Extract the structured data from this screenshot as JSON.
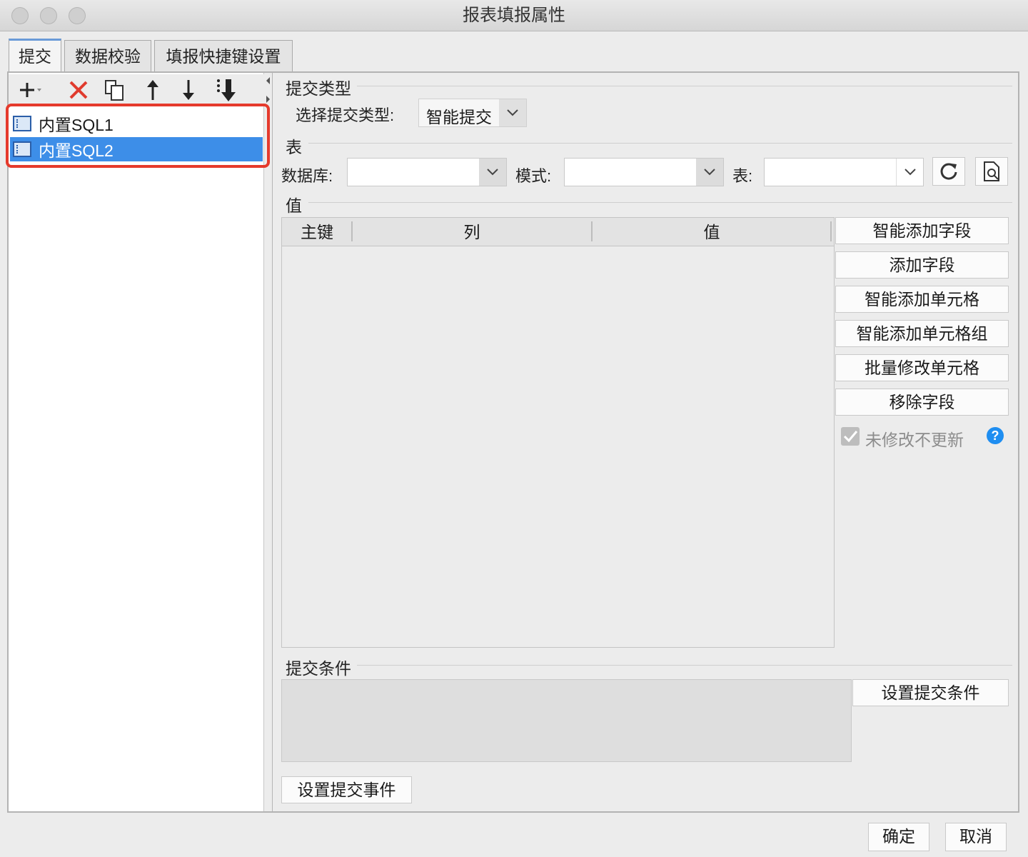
{
  "window": {
    "title": "报表填报属性"
  },
  "tabs": [
    {
      "label": "提交",
      "active": true
    },
    {
      "label": "数据校验",
      "active": false
    },
    {
      "label": "填报快捷键设置",
      "active": false
    }
  ],
  "toolbar": {
    "icons": [
      "add-icon",
      "delete-icon",
      "copy-icon",
      "move-up-icon",
      "move-down-icon",
      "move-bottom-icon"
    ]
  },
  "tree": {
    "items": [
      {
        "label": "内置SQL1",
        "selected": false
      },
      {
        "label": "内置SQL2",
        "selected": true
      }
    ]
  },
  "submit_type": {
    "section_title": "提交类型",
    "select_label": "选择提交类型:",
    "selected": "智能提交"
  },
  "table_section": {
    "section_title": "表",
    "database_label": "数据库:",
    "database_value": "",
    "schema_label": "模式:",
    "schema_value": "",
    "table_label": "表:",
    "table_value": ""
  },
  "values_section": {
    "section_title": "值",
    "columns": [
      "主键",
      "列",
      "值"
    ],
    "rows": []
  },
  "value_buttons": {
    "smart_add_field": "智能添加字段",
    "add_field": "添加字段",
    "smart_add_cell": "智能添加单元格",
    "smart_add_cell_group": "智能添加单元格组",
    "batch_modify_cell": "批量修改单元格",
    "remove_field": "移除字段"
  },
  "no_update_unmodified": {
    "label": "未修改不更新",
    "checked": true,
    "disabled": true
  },
  "condition_section": {
    "section_title": "提交条件",
    "set_condition_button": "设置提交条件"
  },
  "set_event_button": "设置提交事件",
  "footer": {
    "ok": "确定",
    "cancel": "取消"
  },
  "colors": {
    "selection": "#3d8ee8",
    "highlight_border": "#e53a2c",
    "delete_icon": "#e03b2e",
    "help_icon": "#1f8ef1"
  }
}
